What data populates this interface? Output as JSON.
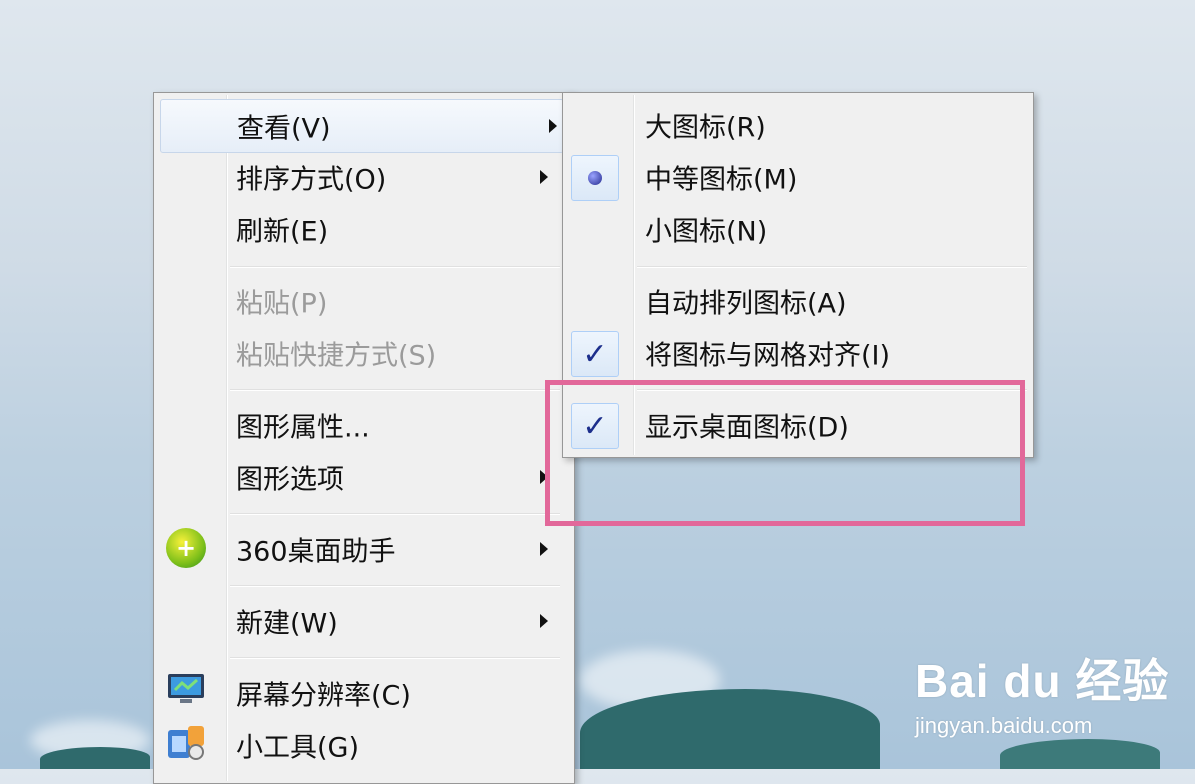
{
  "main_menu": {
    "items": [
      {
        "label": "查看(V)",
        "has_submenu": true,
        "state": "hover"
      },
      {
        "label": "排序方式(O)",
        "has_submenu": true
      },
      {
        "label": "刷新(E)"
      },
      {
        "label": "粘贴(P)",
        "disabled": true
      },
      {
        "label": "粘贴快捷方式(S)",
        "disabled": true
      },
      {
        "label": "图形属性..."
      },
      {
        "label": "图形选项",
        "has_submenu": true
      },
      {
        "label": "360桌面助手",
        "has_submenu": true,
        "icon": "360-icon"
      },
      {
        "label": "新建(W)",
        "has_submenu": true
      },
      {
        "label": "屏幕分辨率(C)",
        "icon": "monitor-icon"
      },
      {
        "label": "小工具(G)",
        "icon": "gadget-icon"
      }
    ]
  },
  "view_submenu": {
    "items": [
      {
        "label": "大图标(R)"
      },
      {
        "label": "中等图标(M)",
        "selected": true,
        "mark": "radio"
      },
      {
        "label": "小图标(N)"
      },
      {
        "label": "自动排列图标(A)"
      },
      {
        "label": "将图标与网格对齐(I)",
        "checked": true,
        "mark": "check"
      },
      {
        "label": "显示桌面图标(D)",
        "checked": true,
        "mark": "check"
      }
    ]
  },
  "marks": {
    "check": "✓"
  },
  "watermark": {
    "brand": "Bai du 经验",
    "url": "jingyan.baidu.com"
  },
  "colors": {
    "highlight": "#e2689a",
    "menu_bg": "#f0f0f0"
  }
}
